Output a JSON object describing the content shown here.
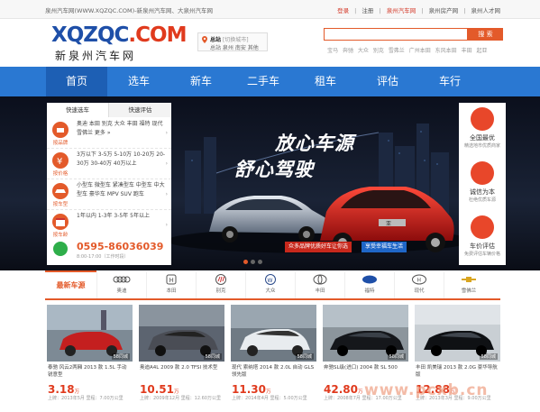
{
  "topbar": {
    "site_desc": "泉州汽车网(WWW.XQZQC.COM)-新泉州汽车网、大泉州汽车网",
    "links": [
      "登录",
      "注册",
      "泉州汽车网",
      "泉州房产网",
      "泉州人才网"
    ],
    "sep": "|"
  },
  "logo": {
    "en_blue": "XQZQC",
    "en_red": ".COM",
    "cn": "新泉州汽车网"
  },
  "location": {
    "title": "总站",
    "switch": "[切换城市]",
    "sub": "总站 泉州 南安 其他"
  },
  "search": {
    "placeholder": "",
    "button": "搜 索"
  },
  "hotwords": [
    "宝马",
    "奔驰",
    "大众",
    "别克",
    "雪弗兰",
    "广州本田",
    "东风本田",
    "丰田",
    "起亚"
  ],
  "nav": [
    {
      "label": "首页",
      "active": true
    },
    {
      "label": "选车",
      "active": false
    },
    {
      "label": "新车",
      "active": false
    },
    {
      "label": "二手车",
      "active": false
    },
    {
      "label": "租车",
      "active": false
    },
    {
      "label": "评估",
      "active": false
    },
    {
      "label": "车行",
      "active": false
    }
  ],
  "quick_panel": {
    "tabs": [
      "快速选车",
      "快速评估"
    ],
    "rows": [
      {
        "label": "按品牌",
        "text": "奥迪 本田 别克 大众 丰田 福特 现代 雪佛兰 更多 »"
      },
      {
        "label": "按价格",
        "text": "3万以下 3-5万 5-10万 10-20万 20-30万 30-40万 40万以上"
      },
      {
        "label": "按车型",
        "text": "小型车 微型车 紧凑型车 中型车 中大型车 豪华车 MPV SUV 跑车"
      },
      {
        "label": "按车龄",
        "text": "1年以内 1-3年 3-5年 5年以上"
      }
    ],
    "phone": "0595-86036039",
    "hours": "8:00-17:00（工作时段）"
  },
  "promise": [
    {
      "title": "全国最优",
      "sub": "精选地市优质商家"
    },
    {
      "title": "诚信为本",
      "sub": "杜绝优质车源"
    },
    {
      "title": "车价评估",
      "sub": "免费评估车辆价格"
    }
  ],
  "banner": {
    "slogan1": "放心车源",
    "slogan2": "舒心驾驶",
    "promo1": "众多品牌优质好车让你选",
    "promo2": "享受幸福车生活",
    "plate_text": "亚"
  },
  "latest_label": "最新车源",
  "brands": [
    "奥迪",
    "本田",
    "别克",
    "大众",
    "丰田",
    "福特",
    "现代",
    "雪佛兰"
  ],
  "cars": [
    {
      "title": "泰驰 风云2两厢 2013 款 1.5L 手动 锐意型",
      "price": "3.18",
      "unit": "万",
      "meta": "上牌：2013年5月   里程：7.00万公里",
      "watermark": "58同城"
    },
    {
      "title": "奥迪A4L 2009 款 2.0 TFSI 技术型",
      "price": "10.51",
      "unit": "万",
      "meta": "上牌：2009年12月   里程：12.60万公里",
      "watermark": "58同城"
    },
    {
      "title": "现代 索纳塔 2014 款 2.0L 自动 GLS 领先版",
      "price": "11.30",
      "unit": "万",
      "meta": "上牌：2014年4月   里程：5.00万公里",
      "watermark": "58同城"
    },
    {
      "title": "奔驰SL级(进口) 2004 款 SL 500",
      "price": "42.80",
      "unit": "万",
      "meta": "上牌：2008年7月   里程：17.00万公里",
      "watermark": "58同城"
    },
    {
      "title": "丰田 凯美瑞 2013 款 2.0G 豪华导航版",
      "price": "12.88",
      "unit": "万",
      "meta": "上牌：2013年3月   里程：9.00万公里",
      "watermark": "58同城"
    }
  ],
  "site_watermark": "www.pcxb.cn",
  "colors": {
    "nav_bg": "#2a78d2",
    "accent": "#e35a2a",
    "price": "#e03a1d"
  }
}
